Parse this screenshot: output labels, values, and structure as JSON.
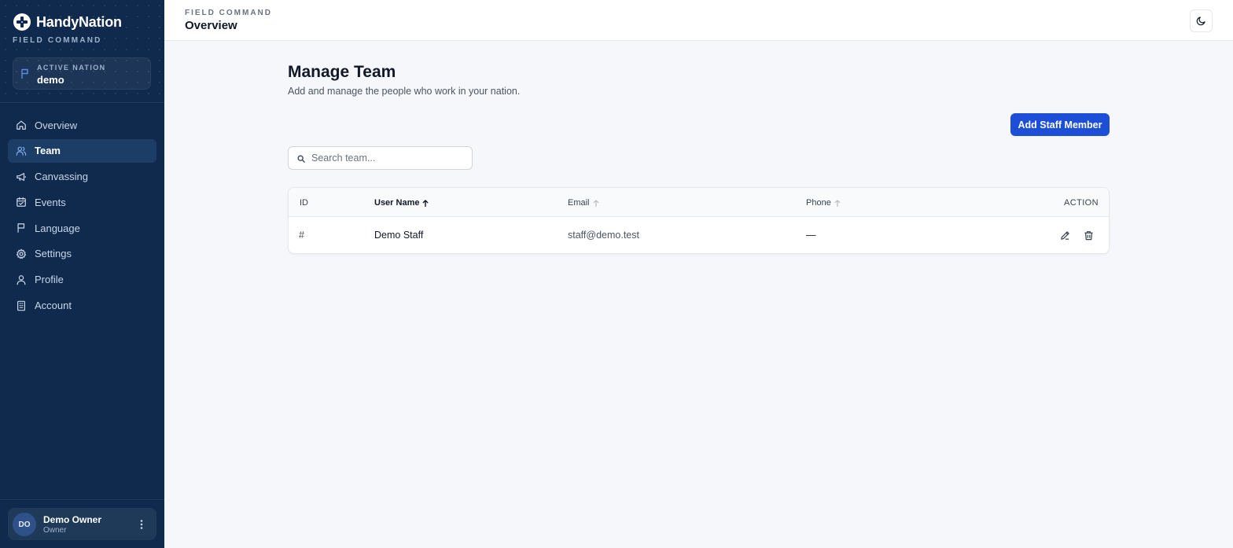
{
  "sidebar": {
    "brand": "HandyNation",
    "brand_sub": "FIELD COMMAND",
    "active_nation_label": "ACTIVE NATION",
    "active_nation_value": "demo",
    "items": [
      {
        "label": "Overview",
        "icon": "home-icon",
        "active": false
      },
      {
        "label": "Team",
        "icon": "users-icon",
        "active": true
      },
      {
        "label": "Canvassing",
        "icon": "megaphone-icon",
        "active": false
      },
      {
        "label": "Events",
        "icon": "calendar-icon",
        "active": false
      },
      {
        "label": "Language",
        "icon": "flag-icon",
        "active": false
      },
      {
        "label": "Settings",
        "icon": "gear-icon",
        "active": false
      },
      {
        "label": "Profile",
        "icon": "user-icon",
        "active": false
      },
      {
        "label": "Account",
        "icon": "building-icon",
        "active": false
      }
    ],
    "user": {
      "initials": "DO",
      "name": "Demo Owner",
      "role": "Owner"
    }
  },
  "header": {
    "eyebrow": "FIELD COMMAND",
    "title": "Overview"
  },
  "main": {
    "title": "Manage Team",
    "subtitle": "Add and manage the people who work in your nation.",
    "add_button": "Add Staff Member",
    "search_placeholder": "Search team...",
    "table": {
      "columns": [
        "ID",
        "User Name",
        "Email",
        "Phone",
        "ACTION"
      ],
      "rows": [
        {
          "id": "#",
          "name": "Demo Staff",
          "email": "staff@demo.test",
          "phone": "—"
        }
      ]
    }
  },
  "colors": {
    "sidebar_bg": "#0f2a4d",
    "accent": "#1d4ed8",
    "page_bg": "#f6f7fb"
  }
}
